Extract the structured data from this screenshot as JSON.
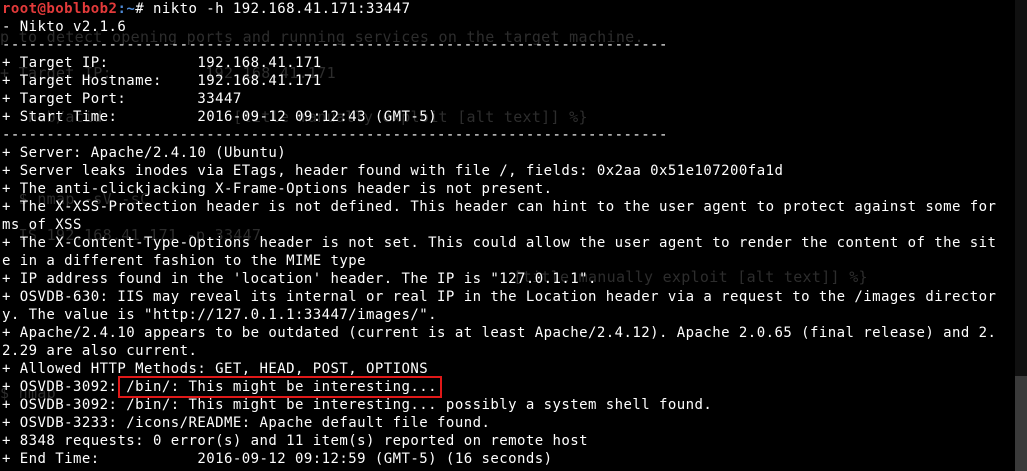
{
  "prompt": {
    "user_host": "root@boblbob2",
    "path": ":~",
    "symbol": "#",
    "command": " nikto -h 192.168.41.171:33447"
  },
  "ghost_text": [
    "p to detect opening ports and running services on the target machine.",
    "+ Target IP:          192.168.41.171",
    "   hub/acid              [title manually exploit [alt text]] %}",
    "  $ nmap -sV -sC",
    "  IS 192.168.41.171 -p 33447",
    "          [title manually exploit [alt text]] %}",
    "$ nmap"
  ],
  "output_lines": [
    "- Nikto v2.1.6",
    "---------------------------------------------------------------------------",
    "+ Target IP:          192.168.41.171",
    "+ Target Hostname:    192.168.41.171",
    "+ Target Port:        33447",
    "+ Start Time:         2016-09-12 09:12:43 (GMT-5)",
    "---------------------------------------------------------------------------",
    "+ Server: Apache/2.4.10 (Ubuntu)",
    "+ Server leaks inodes via ETags, header found with file /, fields: 0x2aa 0x51e107200fa1d",
    "+ The anti-clickjacking X-Frame-Options header is not present.",
    "+ The X-XSS-Protection header is not defined. This header can hint to the user agent to protect against some for",
    "ms of XSS",
    "+ The X-Content-Type-Options header is not set. This could allow the user agent to render the content of the sit",
    "e in a different fashion to the MIME type",
    "+ IP address found in the 'location' header. The IP is \"127.0.1.1\".",
    "+ OSVDB-630: IIS may reveal its internal or real IP in the Location header via a request to the /images director",
    "y. The value is \"http://127.0.1.1:33447/images/\".",
    "+ Apache/2.4.10 appears to be outdated (current is at least Apache/2.4.12). Apache 2.0.65 (final release) and 2.",
    "2.29 are also current.",
    "+ Allowed HTTP Methods: GET, HEAD, POST, OPTIONS",
    "+ OSVDB-3092: /bin/: This might be interesting...",
    "+ OSVDB-3092: /bin/: This might be interesting... possibly a system shell found.",
    "+ OSVDB-3233: /icons/README: Apache default file found.",
    "+ 8348 requests: 0 error(s) and 11 item(s) reported on remote host",
    "+ End Time:           2016-09-12 09:12:59 (GMT-5) (16 seconds)"
  ],
  "highlight": {
    "color": "#e01818",
    "target_line": "+ OSVDB-3092: /bin/: This might be interesting..."
  },
  "colors": {
    "background": "#000000",
    "text": "#ffffff",
    "prompt_user": "#e33a3a",
    "prompt_path": "#4f8bd6"
  }
}
